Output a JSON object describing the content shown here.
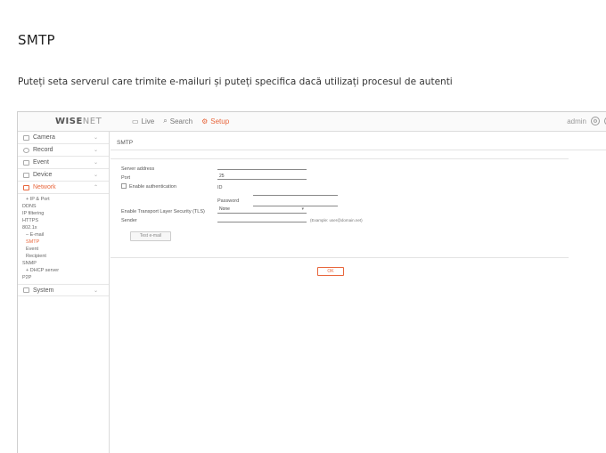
{
  "document": {
    "heading": "SMTP",
    "description": "Puteți seta serverul care trimite e-mailuri și puteți specifica dacă utilizați procesul de autenti"
  },
  "topbar": {
    "logo_main": "WISE",
    "logo_sub": "NET",
    "nav": [
      {
        "label": "Live",
        "icon": "monitor-icon"
      },
      {
        "label": "Search",
        "icon": "search-icon"
      },
      {
        "label": "Setup",
        "icon": "gear-icon",
        "active": true
      }
    ],
    "user": "admin",
    "accent_color": "#e8663c"
  },
  "sidebar": {
    "menus": [
      {
        "label": "Camera"
      },
      {
        "label": "Record"
      },
      {
        "label": "Event"
      },
      {
        "label": "Device"
      },
      {
        "label": "Network",
        "active": true
      },
      {
        "label": "System"
      }
    ],
    "network_items": [
      {
        "label": "IP & Port",
        "level": 2
      },
      {
        "label": "DDNS",
        "level": 1
      },
      {
        "label": "IP filtering",
        "level": 1
      },
      {
        "label": "HTTPS",
        "level": 1
      },
      {
        "label": "802.1x",
        "level": 1
      },
      {
        "label": "E-mail",
        "level": 2
      },
      {
        "label": "SMTP",
        "level": 1,
        "active": true
      },
      {
        "label": "Event",
        "level": 1
      },
      {
        "label": "Recipient",
        "level": 1
      },
      {
        "label": "SNMP",
        "level": 1
      },
      {
        "label": "DHCP server",
        "level": 2
      },
      {
        "label": "P2P",
        "level": 1
      }
    ]
  },
  "smtp": {
    "title": "SMTP",
    "server_address_label": "Server address",
    "port_label": "Port",
    "port_value": "25",
    "enable_auth_label": "Enable authentication",
    "id_label": "ID",
    "password_label": "Password",
    "tls_label": "Enable Transport Layer Security (TLS)",
    "tls_value": "None",
    "sender_label": "Sender",
    "sender_example": "(Example: user@domain.net)",
    "test_button": "Test e-mail",
    "ok_button": "OK"
  }
}
